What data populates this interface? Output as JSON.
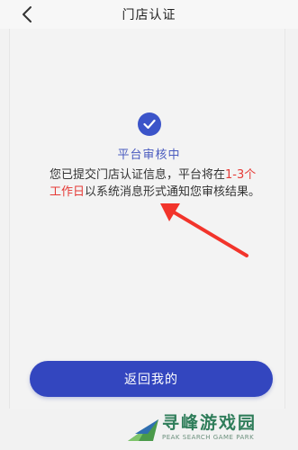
{
  "header": {
    "title": "门店认证"
  },
  "status": {
    "title": "平台审核中"
  },
  "message": {
    "part1": "您已提交门店认证信息，平台将在",
    "highlight": "1-3个工作日",
    "part2": "以系统消息形式通知您审核结果。"
  },
  "actions": {
    "back_label": "返回我的"
  },
  "watermark": {
    "text": "寻峰游戏园",
    "subtext": "PEAK SEARCH GAME PARK"
  },
  "colors": {
    "accent": "#3346bf",
    "highlight": "#e53935",
    "arrow": "#f2342b"
  }
}
